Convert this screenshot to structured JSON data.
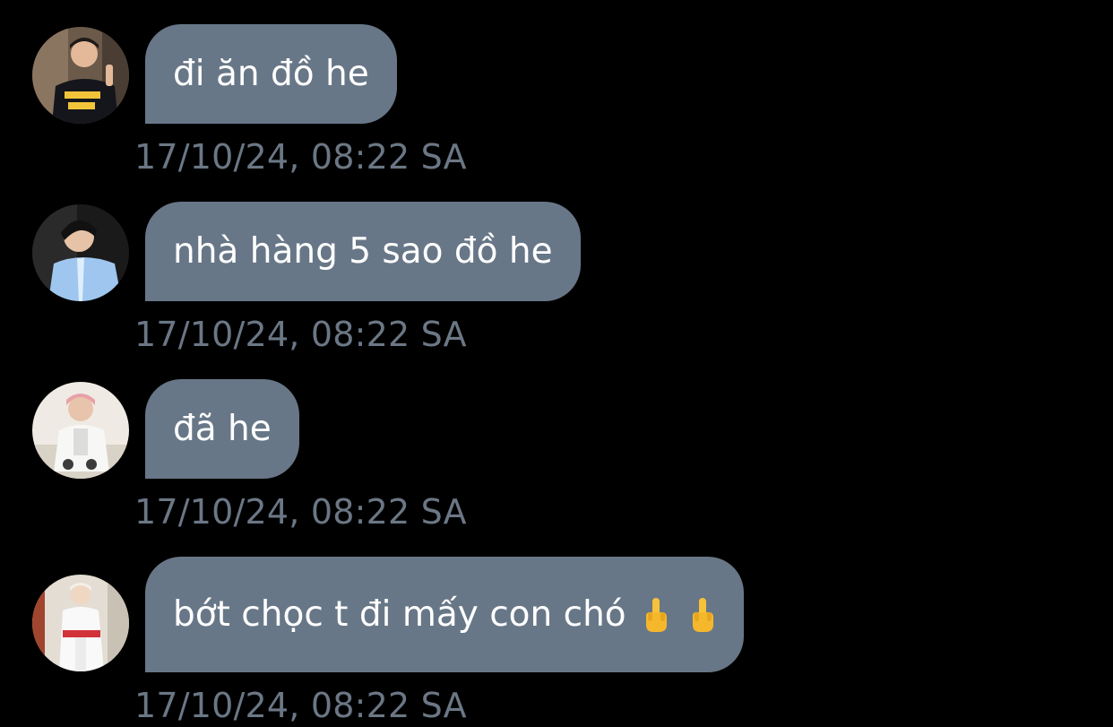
{
  "messages": [
    {
      "text": "đi ăn đồ he",
      "time": "17/10/24, 08:22 SA",
      "avatar_icon": "user-avatar-photo-1",
      "emojis": []
    },
    {
      "text": "nhà hàng 5 sao đồ he",
      "time": "17/10/24, 08:22 SA",
      "avatar_icon": "user-avatar-photo-2",
      "emojis": []
    },
    {
      "text": "đã he",
      "time": "17/10/24, 08:22 SA",
      "avatar_icon": "user-avatar-photo-3",
      "emojis": []
    },
    {
      "text": "bớt chọc t đi mấy con chó",
      "time": "17/10/24, 08:22 SA",
      "avatar_icon": "user-avatar-photo-4",
      "emojis": [
        "middle-finger-emoji",
        "middle-finger-emoji"
      ]
    }
  ],
  "colors": {
    "background": "#000000",
    "bubble": "#687787",
    "bubble_text": "#ffffff",
    "timestamp": "#6b7785"
  }
}
